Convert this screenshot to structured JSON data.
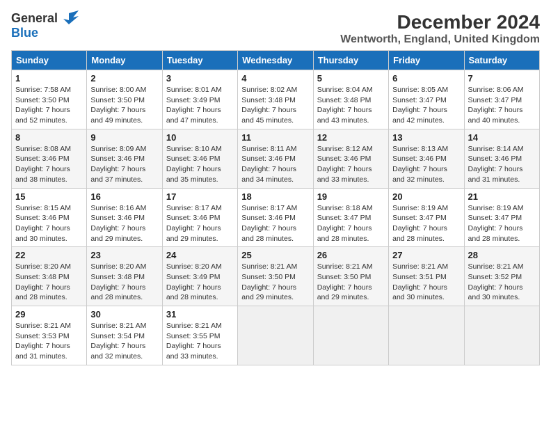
{
  "header": {
    "logo_general": "General",
    "logo_blue": "Blue",
    "title": "December 2024",
    "subtitle": "Wentworth, England, United Kingdom"
  },
  "days_of_week": [
    "Sunday",
    "Monday",
    "Tuesday",
    "Wednesday",
    "Thursday",
    "Friday",
    "Saturday"
  ],
  "weeks": [
    [
      {
        "day": "1",
        "sunrise": "Sunrise: 7:58 AM",
        "sunset": "Sunset: 3:50 PM",
        "daylight": "Daylight: 7 hours and 52 minutes."
      },
      {
        "day": "2",
        "sunrise": "Sunrise: 8:00 AM",
        "sunset": "Sunset: 3:50 PM",
        "daylight": "Daylight: 7 hours and 49 minutes."
      },
      {
        "day": "3",
        "sunrise": "Sunrise: 8:01 AM",
        "sunset": "Sunset: 3:49 PM",
        "daylight": "Daylight: 7 hours and 47 minutes."
      },
      {
        "day": "4",
        "sunrise": "Sunrise: 8:02 AM",
        "sunset": "Sunset: 3:48 PM",
        "daylight": "Daylight: 7 hours and 45 minutes."
      },
      {
        "day": "5",
        "sunrise": "Sunrise: 8:04 AM",
        "sunset": "Sunset: 3:48 PM",
        "daylight": "Daylight: 7 hours and 43 minutes."
      },
      {
        "day": "6",
        "sunrise": "Sunrise: 8:05 AM",
        "sunset": "Sunset: 3:47 PM",
        "daylight": "Daylight: 7 hours and 42 minutes."
      },
      {
        "day": "7",
        "sunrise": "Sunrise: 8:06 AM",
        "sunset": "Sunset: 3:47 PM",
        "daylight": "Daylight: 7 hours and 40 minutes."
      }
    ],
    [
      {
        "day": "8",
        "sunrise": "Sunrise: 8:08 AM",
        "sunset": "Sunset: 3:46 PM",
        "daylight": "Daylight: 7 hours and 38 minutes."
      },
      {
        "day": "9",
        "sunrise": "Sunrise: 8:09 AM",
        "sunset": "Sunset: 3:46 PM",
        "daylight": "Daylight: 7 hours and 37 minutes."
      },
      {
        "day": "10",
        "sunrise": "Sunrise: 8:10 AM",
        "sunset": "Sunset: 3:46 PM",
        "daylight": "Daylight: 7 hours and 35 minutes."
      },
      {
        "day": "11",
        "sunrise": "Sunrise: 8:11 AM",
        "sunset": "Sunset: 3:46 PM",
        "daylight": "Daylight: 7 hours and 34 minutes."
      },
      {
        "day": "12",
        "sunrise": "Sunrise: 8:12 AM",
        "sunset": "Sunset: 3:46 PM",
        "daylight": "Daylight: 7 hours and 33 minutes."
      },
      {
        "day": "13",
        "sunrise": "Sunrise: 8:13 AM",
        "sunset": "Sunset: 3:46 PM",
        "daylight": "Daylight: 7 hours and 32 minutes."
      },
      {
        "day": "14",
        "sunrise": "Sunrise: 8:14 AM",
        "sunset": "Sunset: 3:46 PM",
        "daylight": "Daylight: 7 hours and 31 minutes."
      }
    ],
    [
      {
        "day": "15",
        "sunrise": "Sunrise: 8:15 AM",
        "sunset": "Sunset: 3:46 PM",
        "daylight": "Daylight: 7 hours and 30 minutes."
      },
      {
        "day": "16",
        "sunrise": "Sunrise: 8:16 AM",
        "sunset": "Sunset: 3:46 PM",
        "daylight": "Daylight: 7 hours and 29 minutes."
      },
      {
        "day": "17",
        "sunrise": "Sunrise: 8:17 AM",
        "sunset": "Sunset: 3:46 PM",
        "daylight": "Daylight: 7 hours and 29 minutes."
      },
      {
        "day": "18",
        "sunrise": "Sunrise: 8:17 AM",
        "sunset": "Sunset: 3:46 PM",
        "daylight": "Daylight: 7 hours and 28 minutes."
      },
      {
        "day": "19",
        "sunrise": "Sunrise: 8:18 AM",
        "sunset": "Sunset: 3:47 PM",
        "daylight": "Daylight: 7 hours and 28 minutes."
      },
      {
        "day": "20",
        "sunrise": "Sunrise: 8:19 AM",
        "sunset": "Sunset: 3:47 PM",
        "daylight": "Daylight: 7 hours and 28 minutes."
      },
      {
        "day": "21",
        "sunrise": "Sunrise: 8:19 AM",
        "sunset": "Sunset: 3:47 PM",
        "daylight": "Daylight: 7 hours and 28 minutes."
      }
    ],
    [
      {
        "day": "22",
        "sunrise": "Sunrise: 8:20 AM",
        "sunset": "Sunset: 3:48 PM",
        "daylight": "Daylight: 7 hours and 28 minutes."
      },
      {
        "day": "23",
        "sunrise": "Sunrise: 8:20 AM",
        "sunset": "Sunset: 3:48 PM",
        "daylight": "Daylight: 7 hours and 28 minutes."
      },
      {
        "day": "24",
        "sunrise": "Sunrise: 8:20 AM",
        "sunset": "Sunset: 3:49 PM",
        "daylight": "Daylight: 7 hours and 28 minutes."
      },
      {
        "day": "25",
        "sunrise": "Sunrise: 8:21 AM",
        "sunset": "Sunset: 3:50 PM",
        "daylight": "Daylight: 7 hours and 29 minutes."
      },
      {
        "day": "26",
        "sunrise": "Sunrise: 8:21 AM",
        "sunset": "Sunset: 3:50 PM",
        "daylight": "Daylight: 7 hours and 29 minutes."
      },
      {
        "day": "27",
        "sunrise": "Sunrise: 8:21 AM",
        "sunset": "Sunset: 3:51 PM",
        "daylight": "Daylight: 7 hours and 30 minutes."
      },
      {
        "day": "28",
        "sunrise": "Sunrise: 8:21 AM",
        "sunset": "Sunset: 3:52 PM",
        "daylight": "Daylight: 7 hours and 30 minutes."
      }
    ],
    [
      {
        "day": "29",
        "sunrise": "Sunrise: 8:21 AM",
        "sunset": "Sunset: 3:53 PM",
        "daylight": "Daylight: 7 hours and 31 minutes."
      },
      {
        "day": "30",
        "sunrise": "Sunrise: 8:21 AM",
        "sunset": "Sunset: 3:54 PM",
        "daylight": "Daylight: 7 hours and 32 minutes."
      },
      {
        "day": "31",
        "sunrise": "Sunrise: 8:21 AM",
        "sunset": "Sunset: 3:55 PM",
        "daylight": "Daylight: 7 hours and 33 minutes."
      },
      null,
      null,
      null,
      null
    ]
  ]
}
